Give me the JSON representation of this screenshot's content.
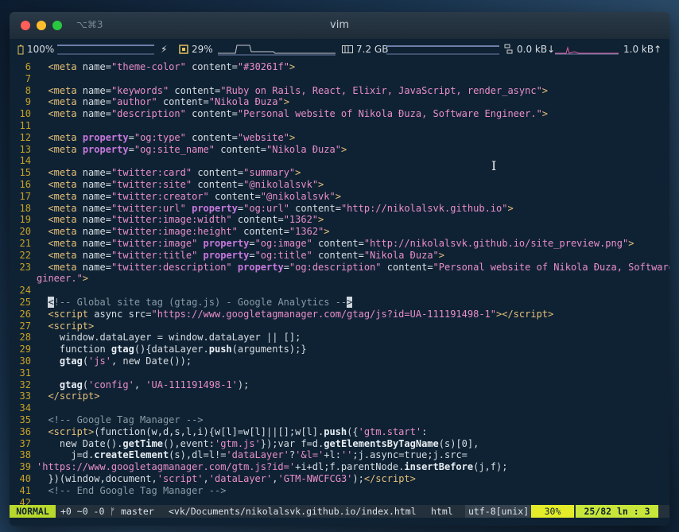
{
  "window": {
    "shortcut": "⌥⌘3",
    "title": "vim"
  },
  "status": {
    "battery": "100%",
    "bolt": "⚡",
    "cpu": "29%",
    "memory": "7.2 GB",
    "net_down": "0.0 kB↓",
    "net_up": "1.0 kB↑"
  },
  "editor": {
    "lines": [
      {
        "n": "6",
        "html": "  <span class='tag'>&lt;meta</span> name=<span class='str'>\"theme-color\"</span> content=<span class='str'>\"#30261f\"</span><span class='tag'>&gt;</span>"
      },
      {
        "n": "7",
        "html": ""
      },
      {
        "n": "8",
        "html": "  <span class='tag'>&lt;meta</span> name=<span class='str'>\"keywords\"</span> content=<span class='str'>\"Ruby on Rails, React, Elixir, JavaScript, render_async\"</span><span class='tag'>&gt;</span>"
      },
      {
        "n": "9",
        "html": "  <span class='tag'>&lt;meta</span> name=<span class='str'>\"author\"</span> content=<span class='str'>\"Nikola Đuza\"</span><span class='tag'>&gt;</span>"
      },
      {
        "n": "10",
        "html": "  <span class='tag'>&lt;meta</span> name=<span class='str'>\"description\"</span> content=<span class='str'>\"Personal website of Nikola Đuza, Software Engineer.\"</span><span class='tag'>&gt;</span>"
      },
      {
        "n": "11",
        "html": ""
      },
      {
        "n": "12",
        "html": "  <span class='tag'>&lt;meta</span> <span class='attrb'>property</span>=<span class='str'>\"og:type\"</span> content=<span class='str'>\"website\"</span><span class='tag'>&gt;</span>"
      },
      {
        "n": "13",
        "html": "  <span class='tag'>&lt;meta</span> <span class='attrb'>property</span>=<span class='str'>\"og:site_name\"</span> content=<span class='str'>\"Nikola Đuza\"</span><span class='tag'>&gt;</span>"
      },
      {
        "n": "14",
        "html": ""
      },
      {
        "n": "15",
        "html": "  <span class='tag'>&lt;meta</span> name=<span class='str'>\"twitter:card\"</span> content=<span class='str'>\"summary\"</span><span class='tag'>&gt;</span>"
      },
      {
        "n": "16",
        "html": "  <span class='tag'>&lt;meta</span> name=<span class='str'>\"twitter:site\"</span> content=<span class='str'>\"@nikolalsvk\"</span><span class='tag'>&gt;</span>"
      },
      {
        "n": "17",
        "html": "  <span class='tag'>&lt;meta</span> name=<span class='str'>\"twitter:creator\"</span> content=<span class='str'>\"@nikolalsvk\"</span><span class='tag'>&gt;</span>"
      },
      {
        "n": "18",
        "html": "  <span class='tag'>&lt;meta</span> name=<span class='str'>\"twitter:url\"</span> <span class='attrb'>property</span>=<span class='str'>\"og:url\"</span> content=<span class='str'>\"http://nikolalsvk.github.io\"</span><span class='tag'>&gt;</span>"
      },
      {
        "n": "19",
        "html": "  <span class='tag'>&lt;meta</span> name=<span class='str'>\"twitter:image:width\"</span> content=<span class='str'>\"1362\"</span><span class='tag'>&gt;</span>"
      },
      {
        "n": "20",
        "html": "  <span class='tag'>&lt;meta</span> name=<span class='str'>\"twitter:image:height\"</span> content=<span class='str'>\"1362\"</span><span class='tag'>&gt;</span>"
      },
      {
        "n": "21",
        "html": "  <span class='tag'>&lt;meta</span> name=<span class='str'>\"twitter:image\"</span> <span class='attrb'>property</span>=<span class='str'>\"og:image\"</span> content=<span class='str'>\"http://nikolalsvk.github.io/site_preview.png\"</span><span class='tag'>&gt;</span>"
      },
      {
        "n": "22",
        "html": "  <span class='tag'>&lt;meta</span> name=<span class='str'>\"twitter:title\"</span> <span class='attrb'>property</span>=<span class='str'>\"og:title\"</span> content=<span class='str'>\"Nikola Đuza\"</span><span class='tag'>&gt;</span>"
      },
      {
        "n": "23",
        "html": "  <span class='tag'>&lt;meta</span> name=<span class='str'>\"twitter:description\"</span> <span class='attrb'>property</span>=<span class='str'>\"og:description\"</span> content=<span class='str'>\"Personal website of Nikola Đuza, Software En</span>"
      },
      {
        "n": "",
        "html": "<span class='str'>gineer.\"</span><span class='tag'>&gt;</span>"
      },
      {
        "n": "24",
        "html": ""
      },
      {
        "n": "25",
        "html": "  <span class='cursor'>&lt;</span><span class='cm'>!-- Global site tag (gtag.js) - Google Analytics --</span><span class='cursor'>&gt;</span>"
      },
      {
        "n": "26",
        "html": "  <span class='tag'>&lt;script</span> async src=<span class='str'>\"https://www.googletagmanager.com/gtag/js?id=UA-111191498-1\"</span><span class='tag'>&gt;&lt;/script&gt;</span>"
      },
      {
        "n": "27",
        "html": "  <span class='tag'>&lt;script&gt;</span>"
      },
      {
        "n": "28",
        "html": "    window.dataLayer = window.dataLayer || [];"
      },
      {
        "n": "29",
        "html": "    function <span class='fn'>gtag</span>(){dataLayer.<span class='fn'>push</span>(arguments);}"
      },
      {
        "n": "30",
        "html": "    <span class='fn'>gtag</span>(<span class='str'>'js'</span>, new Date());"
      },
      {
        "n": "31",
        "html": ""
      },
      {
        "n": "32",
        "html": "    <span class='fn'>gtag</span>(<span class='str'>'config'</span>, <span class='str'>'UA-111191498-1'</span>);"
      },
      {
        "n": "33",
        "html": "  <span class='tag'>&lt;/script&gt;</span>"
      },
      {
        "n": "34",
        "html": ""
      },
      {
        "n": "35",
        "html": "  <span class='cm'>&lt;!-- Google Tag Manager --&gt;</span>"
      },
      {
        "n": "36",
        "html": "  <span class='tag'>&lt;script&gt;</span>(function(w,d,s,l,i){w[l]=w[l]||[];w[l].<span class='fn'>push</span>({<span class='str'>'gtm.start'</span>:"
      },
      {
        "n": "37",
        "html": "    new Date().<span class='fn'>getTime</span>(),event:<span class='str'>'gtm.js'</span>});var f=d.<span class='fn'>getElementsByTagName</span>(s)[0],"
      },
      {
        "n": "38",
        "html": "      j=d.<span class='fn'>createElement</span>(s),dl=l!=<span class='str'>'dataLayer'</span>?<span class='str'>'&amp;l='</span>+l:<span class='str'>''</span>;j.async=true;j.src="
      },
      {
        "n": "39",
        "html": "<span class='str'>'https://www.googletagmanager.com/gtm.js?id='</span>+i+dl;f.parentNode.<span class='fn'>insertBefore</span>(j,f);"
      },
      {
        "n": "40",
        "html": "  })(window,document,<span class='str'>'script'</span>,<span class='str'>'dataLayer'</span>,<span class='str'>'GTM-NWCFCG3'</span>);<span class='tag'>&lt;/script&gt;</span>"
      },
      {
        "n": "41",
        "html": "  <span class='cm'>&lt;!-- End Google Tag Manager --&gt;</span>"
      },
      {
        "n": "42",
        "html": ""
      }
    ]
  },
  "modeline": {
    "mode": "NORMAL",
    "git": "+0 ~0 -0 ᚠ master",
    "file": "<vk/Documents/nikolalsvk.github.io/index.html",
    "filetype": "html",
    "encoding": "utf-8[unix]",
    "percent": "30%",
    "position": "25/82  ln :  3"
  }
}
